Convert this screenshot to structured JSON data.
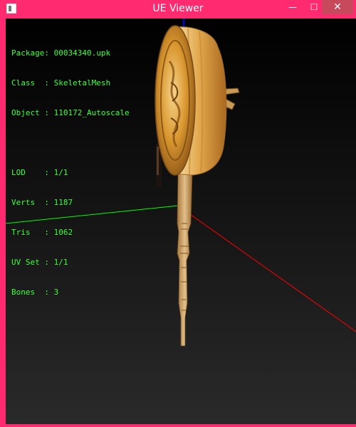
{
  "window": {
    "title": "UE Viewer",
    "minimize_glyph": "—",
    "maximize_glyph": "☐",
    "close_glyph": "✕",
    "app_icon": "app-icon"
  },
  "info": {
    "package": "Package: 00034340.upk",
    "class": "Class  : SkeletalMesh",
    "object": "Object : 110172_Autoscale",
    "lod": "LOD    : 1/1",
    "verts": "Verts  : 1187",
    "tris": "Tris   : 1062",
    "uvset": "UV Set : 1/1",
    "bones": "Bones  : 3"
  },
  "colors": {
    "frame": "#ff2a6f",
    "text": "#3cff3c",
    "axis_x": "#ff0000",
    "axis_y": "#00ff00",
    "axis_z": "#0000ff",
    "mesh_gold": "#d9962e"
  },
  "scene": {
    "subject": "mooncake-on-stick skeletal mesh"
  }
}
